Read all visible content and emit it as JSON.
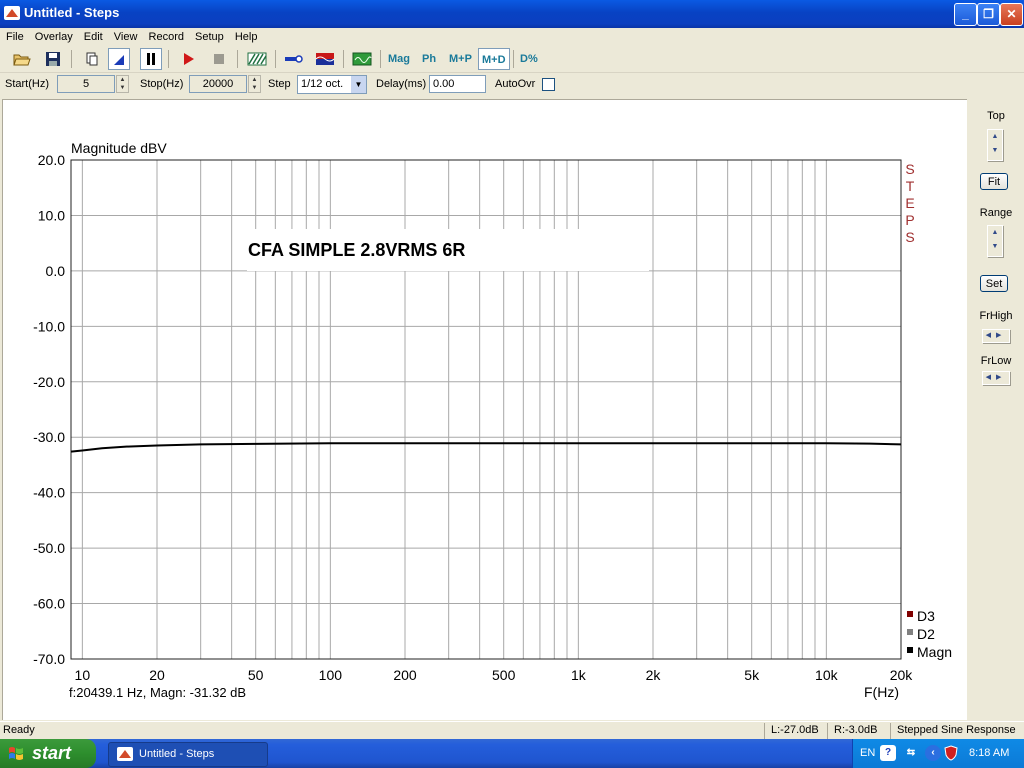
{
  "window": {
    "title": "Untitled - Steps",
    "buttons": {
      "minimize": "_",
      "maximize": "❐",
      "close": "✕"
    }
  },
  "menu": [
    "File",
    "Overlay",
    "Edit",
    "View",
    "Record",
    "Setup",
    "Help"
  ],
  "toolbar": {
    "mag_label": "Mag",
    "ph_label": "Ph",
    "mp_label": "M+P",
    "md_label": "M+D",
    "dpct_label": "D%",
    "icons": [
      "open-folder-icon",
      "save-icon",
      "copy-icon",
      "cursor-icon",
      "pause-icon",
      "play-icon",
      "stop-icon",
      "pattern-icon",
      "probe-icon",
      "spectrum-icon",
      "monitor-icon"
    ]
  },
  "params": {
    "start_label": "Start(Hz)",
    "start_value": "5",
    "stop_label": "Stop(Hz)",
    "stop_value": "20000",
    "step_label": "Step",
    "step_value": "1/12 oct.",
    "delay_label": "Delay(ms)",
    "delay_value": "0.00",
    "autoovr_label": "AutoOvr"
  },
  "right_panel": {
    "top_label": "Top",
    "fit_label": "Fit",
    "range_label": "Range",
    "set_label": "Set",
    "frhigh_label": "FrHigh",
    "frlow_label": "FrLow"
  },
  "chart_data": {
    "type": "line",
    "title": "CFA SIMPLE 2.8VRMS 6R",
    "ylabel": "Magnitude dBV",
    "xlabel": "F(Hz)",
    "side_label": "STEPS",
    "xscale": "log",
    "xlim": [
      9,
      20000
    ],
    "ylim": [
      -70,
      20
    ],
    "yticks": [
      20,
      10,
      0,
      -10,
      -20,
      -30,
      -40,
      -50,
      -60,
      -70
    ],
    "ytick_labels": [
      "20.0",
      "10.0",
      "0.0",
      "-10.0",
      "-20.0",
      "-30.0",
      "-40.0",
      "-50.0",
      "-60.0",
      "-70.0"
    ],
    "xticks": [
      10,
      20,
      50,
      100,
      200,
      500,
      1000,
      2000,
      5000,
      10000,
      20000
    ],
    "xtick_labels": [
      "10",
      "20",
      "50",
      "100",
      "200",
      "500",
      "1k",
      "2k",
      "5k",
      "10k",
      "20k"
    ],
    "grid": true,
    "legend": [
      "D3",
      "D2",
      "Magn"
    ],
    "legend_colors": [
      "#800000",
      "#808080",
      "#000000"
    ],
    "legend_placement": "bottom-right",
    "cursor_readout": "f:20439.1 Hz, Magn: -31.32 dB",
    "series": [
      {
        "name": "Magn",
        "color": "#000000",
        "x": [
          9,
          10,
          12,
          15,
          20,
          30,
          50,
          100,
          200,
          500,
          1000,
          2000,
          5000,
          10000,
          15000,
          20000
        ],
        "y": [
          -32.6,
          -32.4,
          -32.0,
          -31.7,
          -31.5,
          -31.3,
          -31.2,
          -31.1,
          -31.1,
          -31.1,
          -31.1,
          -31.1,
          -31.1,
          -31.1,
          -31.15,
          -31.3
        ]
      }
    ]
  },
  "status": {
    "ready": "Ready",
    "left_level": "L:-27.0dB",
    "right_level": "R:-3.0dB",
    "mode": "Stepped Sine Response"
  },
  "taskbar": {
    "start_label": "start",
    "task_label": "Untitled - Steps",
    "lang": "EN",
    "help_glyph": "?",
    "clock": "8:18 AM"
  }
}
